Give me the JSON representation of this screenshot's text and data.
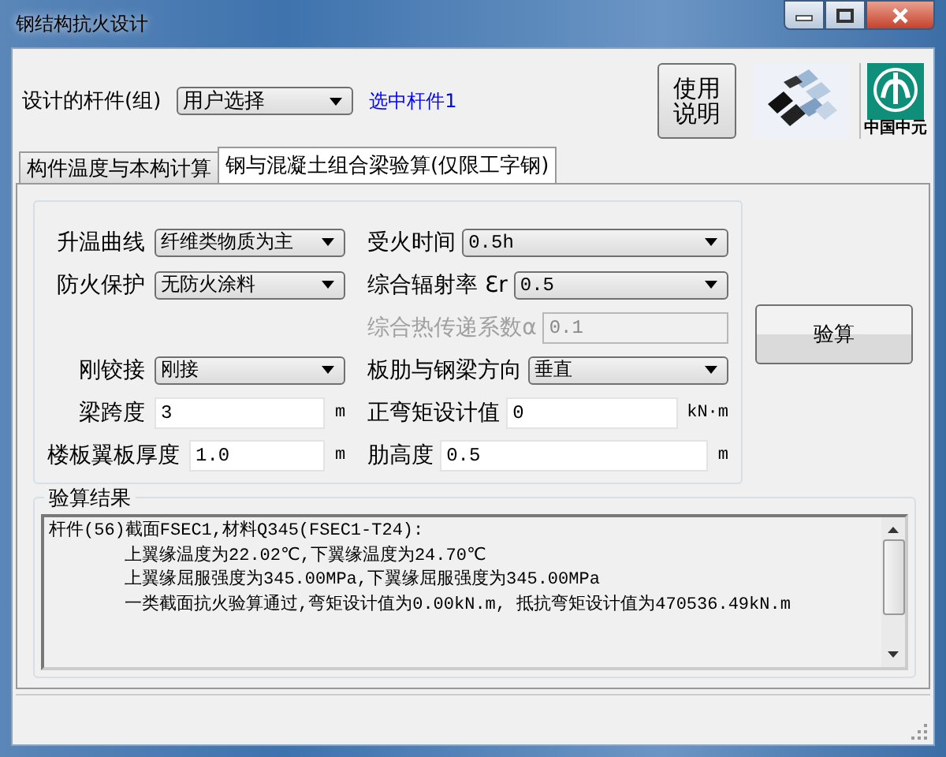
{
  "window": {
    "title": "钢结构抗火设计"
  },
  "member": {
    "label": "设计的杆件(组)",
    "value": "用户选择",
    "link": "选中杆件1"
  },
  "help_button": "使用说明",
  "logo_caption": "中国中元",
  "tabs": [
    {
      "label": "构件温度与本构计算",
      "selected": false
    },
    {
      "label": "钢与混凝土组合梁验算(仅限工字钢)",
      "selected": true
    }
  ],
  "rows": [
    {
      "left": {
        "kind": "combo",
        "label": "升温曲线",
        "value": "纤维类物质为主"
      },
      "right": {
        "kind": "combo",
        "label": "受火时间",
        "value": "0.5h"
      }
    },
    {
      "left": {
        "kind": "combo",
        "label": "防火保护",
        "value": "无防火涂料"
      },
      "right": {
        "kind": "combo",
        "label": "综合辐射率 Ɛr",
        "value": "0.5"
      }
    },
    {
      "right": {
        "kind": "input",
        "label": "综合热传递系数α",
        "value": "0.1",
        "disabled": true
      }
    },
    {
      "left": {
        "kind": "combo",
        "label": "刚铰接",
        "value": "刚接"
      },
      "right": {
        "kind": "combo",
        "label": "板肋与钢梁方向",
        "value": "垂直"
      }
    },
    {
      "left": {
        "kind": "input",
        "label": "梁跨度",
        "value": "3",
        "unit": "m",
        "disabled": false
      },
      "right": {
        "kind": "input",
        "label": "正弯矩设计值",
        "value": "0",
        "unit": "kN·m",
        "disabled": false
      }
    },
    {
      "left": {
        "kind": "input",
        "label": "楼板翼板厚度",
        "value": "1.0",
        "unit": "m",
        "disabled": false
      },
      "right": {
        "kind": "input",
        "label": "肋高度",
        "value": "0.5",
        "unit": "m",
        "disabled": false
      }
    }
  ],
  "verify_button": "验算",
  "result": {
    "title": "验算结果",
    "lines": [
      {
        "text": "杆件(56)截面FSEC1,材料Q345(FSEC1-T24):",
        "indented": false
      },
      {
        "text": "上翼缘温度为22.02℃,下翼缘温度为24.70℃",
        "indented": true
      },
      {
        "text": "上翼缘屈服强度为345.00MPa,下翼缘屈服强度为345.00MPa",
        "indented": true
      },
      {
        "text": "一类截面抗火验算通过,弯矩设计值为0.00kN.m, 抵抗弯矩设计值为470536.49kN.m",
        "indented": true
      }
    ]
  }
}
